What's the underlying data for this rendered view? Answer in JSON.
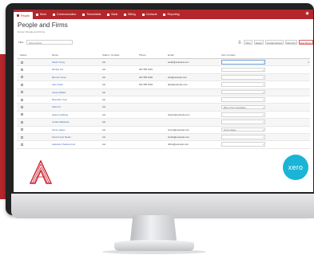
{
  "app": {
    "nav": [
      {
        "label": "People",
        "active": true
      },
      {
        "label": "Work",
        "active": false
      },
      {
        "label": "Communication",
        "active": false
      },
      {
        "label": "Timesheets",
        "active": false
      },
      {
        "label": "Bank",
        "active": false
      },
      {
        "label": "Billing",
        "active": false
      },
      {
        "label": "Contacts",
        "active": false
      },
      {
        "label": "Reporting",
        "active": false
      }
    ],
    "notification_icon": "bell-icon",
    "accent_color": "#b3262c"
  },
  "page": {
    "title": "People and Firms",
    "breadcrumb": "Home  /  People and Firms"
  },
  "filters": {
    "label": "Filter",
    "select_value": "Show Active"
  },
  "toolbar": {
    "buttons": [
      "Print",
      "Export",
      "Contact Actions",
      "New Firm"
    ],
    "primary_button": "New Person"
  },
  "table": {
    "columns": [
      "Select",
      "Name",
      "Status / Contact",
      "Phone",
      "Email",
      "Xero Contact"
    ],
    "rows": [
      {
        "name": "Sarah Young",
        "status": "Act",
        "phone": "",
        "email": "sarah@example.com",
        "xero": "",
        "xero_open": true
      },
      {
        "name": "Murphy Ltd",
        "status": "Act",
        "phone": "021 555 0101",
        "email": "",
        "xero": "",
        "xero_open": false
      },
      {
        "name": "Bennett Jones",
        "status": "Act",
        "phone": "021 555 0102",
        "email": "info@example.com",
        "xero": "",
        "xero_open": false
      },
      {
        "name": "Alan Carter",
        "status": "Act",
        "phone": "021 555 0103",
        "email": "alan@example.com",
        "xero": "",
        "xero_open": false
      },
      {
        "name": "James Walker",
        "status": "Act",
        "phone": "",
        "email": "",
        "xero": "",
        "xero_open": false
      },
      {
        "name": "Riverside Trust",
        "status": "Act",
        "phone": "",
        "email": "",
        "xero": "",
        "xero_open": false
      },
      {
        "name": "Kate Fox",
        "status": "Act",
        "phone": "",
        "email": "",
        "xero": "Bloom Tree Consultants",
        "xero_open": false
      },
      {
        "name": "Harper Holdings",
        "status": "Act",
        "phone": "",
        "email": "harper@example.com",
        "xero": "",
        "xero_open": false
      },
      {
        "name": "Jordan Matthews",
        "status": "Act",
        "phone": "",
        "email": "",
        "xero": "",
        "xero_open": false
      },
      {
        "name": "Simon Hayes",
        "status": "Act",
        "phone": "",
        "email": "simon@example.com",
        "xero": "Simon Hayes",
        "xero_open": false
      },
      {
        "name": "Sarah Lloyd Studio",
        "status": "Act",
        "phone": "",
        "email": "studio@example.com",
        "xero": "",
        "xero_open": false
      },
      {
        "name": "Lakeside Chartered Ltd",
        "status": "Act",
        "phone": "",
        "email": "office@example.com",
        "xero": "",
        "xero_open": false
      }
    ]
  },
  "branding": {
    "xero_logo_text": "xero",
    "xero_color": "#1ab4d7"
  }
}
